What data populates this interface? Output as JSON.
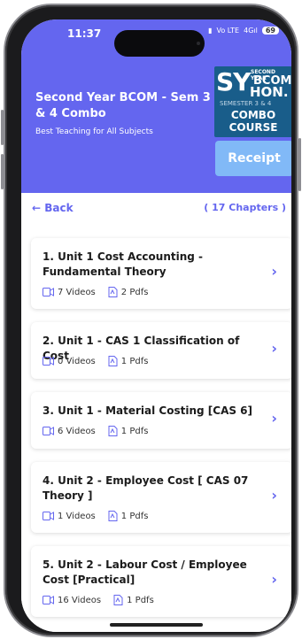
{
  "status_bar": {
    "time": "11:37",
    "network": "Vo LTE",
    "signal": "4G",
    "battery": "69"
  },
  "course": {
    "title": "Second Year BCOM - Sem 3 & 4 Combo",
    "subtitle": "Best Teaching for All Subjects",
    "thumbnail": {
      "sy": "SY",
      "year": "SECOND YEAR",
      "bcom": "BCOM",
      "hon": "HON.",
      "semester": "SEMESTER 3 & 4",
      "combo": "COMBO",
      "course": "COURSE"
    },
    "receipt_label": "Receipt"
  },
  "nav": {
    "back_label": "← Back",
    "chapter_count": "( 17 Chapters )"
  },
  "units": [
    {
      "title": "1. Unit 1 Cost Accounting - Fundamental Theory",
      "videos": "7 Videos",
      "pdfs": "2 Pdfs"
    },
    {
      "title": "2. Unit 1 - CAS 1 Classification of Cost",
      "videos": "0 Videos",
      "pdfs": "1 Pdfs"
    },
    {
      "title": "3. Unit 1 - Material Costing [CAS 6]",
      "videos": "6 Videos",
      "pdfs": "1 Pdfs"
    },
    {
      "title": "4. Unit 2 - Employee Cost [ CAS 07 Theory ]",
      "videos": "1 Videos",
      "pdfs": "1 Pdfs"
    },
    {
      "title": "5. Unit 2 - Labour Cost / Employee Cost [Practical]",
      "videos": "16 Videos",
      "pdfs": "1 Pdfs"
    }
  ],
  "colors": {
    "accent": "#6466ef",
    "receipt": "#81b9f7",
    "thumbnail": "#195d8a"
  }
}
